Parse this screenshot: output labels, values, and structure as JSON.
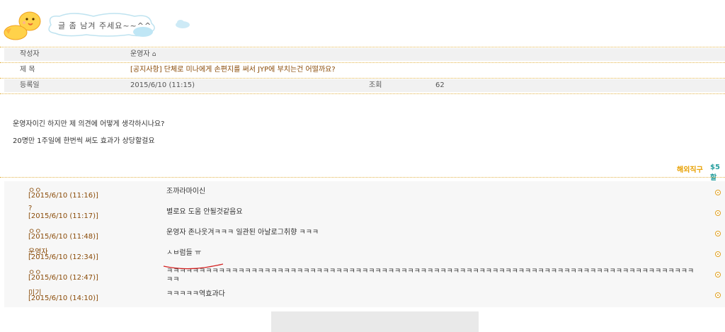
{
  "header": {
    "banner_text": "글 좀 남겨 주세요~~^^"
  },
  "post": {
    "author_label": "작성자",
    "author": "운영자",
    "title_label": "제 목",
    "title": "[공지사항] 단체로 미나에게 손편지를 써서 JYP에 부치는건 어떨까요?",
    "date_label": "등록일",
    "date": "2015/6/10 (11:15)",
    "views_label": "조회",
    "views": "62"
  },
  "body": {
    "line1": "운영자이긴 하지만 제 의견에 어떻게 생각하시나요?",
    "line2": "20명만 1주일에 한번씩 써도 효과가 상당할걸요"
  },
  "ad": {
    "label1": "해외직구",
    "label2": "$5할"
  },
  "comments": [
    {
      "author": "ㅇㅇ",
      "date": "[2015/6/10 (11:16)]",
      "text": "조까라마이신"
    },
    {
      "author": "?",
      "date": "[2015/6/10 (11:17)]",
      "text": "별로요 도움 안될것같음요"
    },
    {
      "author": "ㅇㅇ",
      "date": "[2015/6/10 (11:48)]",
      "text": "운영자 존나웃겨ㅋㅋㅋ 일관된 아날로그취향 ㅋㅋㅋ"
    },
    {
      "author": "운영자",
      "date": "[2015/6/10 (12:34)]",
      "text": "ㅅㅂ럼들 ㅠ"
    },
    {
      "author": "ㅇㅇ",
      "date": "[2015/6/10 (12:47)]",
      "text": "ㅋㅋㅋㅋㅋㅋㅋㅋㅋㅋㅋㅋㅋㅋㅋㅋㅋㅋㅋㅋㅋㅋㅋㅋㅋㅋㅋㅋㅋㅋㅋㅋㅋㅋㅋㅋㅋㅋㅋㅋㅋㅋㅋㅋㅋㅋㅋㅋㅋㅋㅋㅋㅋㅋㅋㅋㅋㅋㅋㅋㅋㅋㅋㅋㅋㅋㅋㅋㅋㅋㅋㅋㅋㅋㅋㅋㅋㅋㅋㅋㅋㅋㅋ"
    },
    {
      "author": "미기",
      "date": "[2015/6/10 (14:10)]",
      "text": "ㅋㅋㅋㅋㅋ역효과다"
    }
  ],
  "colors": {
    "accent": "#8a4b08",
    "ad_orange": "#e8a000",
    "ad_teal": "#2aa0a0",
    "dotted": "#e2b449"
  }
}
